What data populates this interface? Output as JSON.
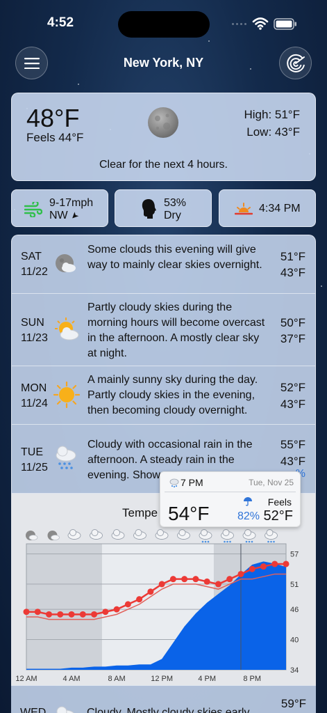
{
  "status_bar": {
    "time": "4:52"
  },
  "header": {
    "location": "New York, NY"
  },
  "current": {
    "temperature": "48°F",
    "feels_like": "Feels 44°F",
    "high": "High: 51°F",
    "low": "Low: 43°F",
    "summary": "Clear for the next 4 hours."
  },
  "chips": {
    "wind_speed": "9-17mph",
    "wind_direction": "NW",
    "humidity_value": "53%",
    "humidity_label": "Dry",
    "sunset_time": "4:34 PM"
  },
  "forecast": [
    {
      "day": "SAT",
      "date": "11/22",
      "icon": "partly-cloudy-night-icon",
      "description": "Some clouds this evening will give way to mainly clear skies overnight.",
      "high": "51°F",
      "low": "43°F"
    },
    {
      "day": "SUN",
      "date": "11/23",
      "icon": "partly-cloudy-day-icon",
      "description": "Partly cloudy skies during the morning hours will become overcast in the afternoon. A mostly clear sky at night.",
      "high": "50°F",
      "low": "37°F"
    },
    {
      "day": "MON",
      "date": "11/24",
      "icon": "sunny-icon",
      "description": "A mainly sunny sky during the day. Partly cloudy skies in the evening, then becoming cloudy overnight.",
      "high": "52°F",
      "low": "43°F"
    },
    {
      "day": "TUE",
      "date": "11/25",
      "icon": "rain-icon",
      "description": "Cloudy with occasional rain in the afternoon. A steady rain in the evening. Show",
      "high": "55°F",
      "low": "43°F",
      "precip_peek": "%"
    }
  ],
  "graph": {
    "title": "Tempe"
  },
  "tooltip": {
    "hour": "7 PM",
    "date": "Tue, Nov 25",
    "temperature": "54°F",
    "precip": "82%",
    "feels_label": "Feels",
    "feels": "52°F"
  },
  "next_day": {
    "day": "WED",
    "description": "Cloudy. Mostly cloudy skies early",
    "high": "59°F"
  },
  "chart_data": {
    "type": "line",
    "x_labels": [
      "12 AM",
      "4 AM",
      "8 AM",
      "12 PM",
      "4 PM",
      "8 PM"
    ],
    "y_ticks": [
      57,
      51,
      46,
      40,
      34
    ],
    "ylim": [
      34,
      59
    ],
    "hours": [
      0,
      1,
      2,
      3,
      4,
      5,
      6,
      7,
      8,
      9,
      10,
      11,
      12,
      13,
      14,
      15,
      16,
      17,
      18,
      19,
      20,
      21,
      22,
      23
    ],
    "series": [
      {
        "values": [
          45.5,
          45.5,
          45,
          45,
          45,
          45,
          45,
          45.5,
          46,
          47,
          48,
          49.5,
          51,
          52,
          52,
          52,
          51.5,
          51,
          52,
          53,
          54,
          54.5,
          55,
          55
        ]
      },
      {
        "values": [
          44.5,
          44.5,
          44,
          44,
          44,
          44,
          44,
          44.5,
          45,
          46,
          47,
          48.5,
          50,
          51,
          51,
          51,
          50.5,
          50,
          51,
          52,
          52,
          52.5,
          53,
          53
        ]
      },
      {
        "values": [
          1,
          1,
          1,
          1,
          2,
          2,
          3,
          3,
          4,
          4,
          5,
          5,
          10,
          25,
          40,
          52,
          62,
          70,
          78,
          88,
          97,
          100,
          98,
          95
        ]
      }
    ],
    "hour_icons": [
      "moon",
      "moon",
      "cloud",
      "cloud",
      "cloud",
      "cloud",
      "cloud",
      "cloud",
      "rain",
      "rain",
      "rain",
      "rain"
    ]
  }
}
